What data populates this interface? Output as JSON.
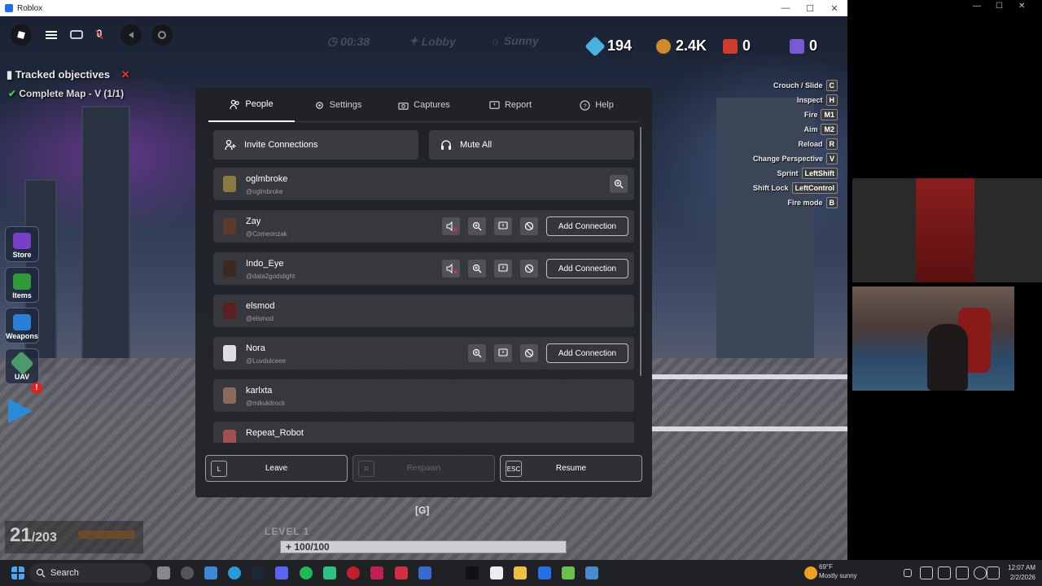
{
  "window": {
    "title": "Roblox",
    "min": "—",
    "max": "☐",
    "close": "✕"
  },
  "hud": {
    "timer": "00:38",
    "mode": "Lobby",
    "weather": "Sunny",
    "gems": "194",
    "burgers": "2.4K",
    "rockets": "0",
    "crystals": "0",
    "tracked_title": "Tracked objectives",
    "objective": "Complete Map - V (1/1)",
    "ammo_current": "21",
    "ammo_total": "/203",
    "level": "LEVEL 1",
    "health": "+ 100/100",
    "g_key": "[G]"
  },
  "keybinds": [
    {
      "label": "Crouch / Slide",
      "key": "C"
    },
    {
      "label": "Inspect",
      "key": "H"
    },
    {
      "label": "Fire",
      "key": "M1"
    },
    {
      "label": "Aim",
      "key": "M2"
    },
    {
      "label": "Reload",
      "key": "R"
    },
    {
      "label": "Change Perspective",
      "key": "V"
    },
    {
      "label": "Sprint",
      "key": "LeftShift"
    },
    {
      "label": "Shift Lock",
      "key": "LeftControl"
    },
    {
      "label": "Fire mode",
      "key": "B"
    }
  ],
  "sidebar": [
    {
      "label": "Store",
      "color": "#7a3fc7"
    },
    {
      "label": "Items",
      "color": "#2f9a3a"
    },
    {
      "label": "Weapons",
      "color": "#2a7fd6"
    },
    {
      "label": "UAV",
      "color": "#4a9a6a"
    }
  ],
  "menu": {
    "tabs": [
      {
        "label": "People",
        "icon": "people-icon"
      },
      {
        "label": "Settings",
        "icon": "gear-icon"
      },
      {
        "label": "Captures",
        "icon": "camera-icon"
      },
      {
        "label": "Report",
        "icon": "report-icon"
      },
      {
        "label": "Help",
        "icon": "help-icon"
      }
    ],
    "invite_label": "Invite Connections",
    "mute_all_label": "Mute All",
    "add_connection_label": "Add Connection",
    "players": [
      {
        "name": "oglmbroke",
        "handle": "@oglmbroke",
        "avatar": "#8a7a40"
      },
      {
        "name": "Zay",
        "handle": "@Comeonzak",
        "avatar": "#5a3a2a"
      },
      {
        "name": "Indo_Eye",
        "handle": "@data2godslight",
        "avatar": "#3a2a20"
      },
      {
        "name": "elsmod",
        "handle": "@elsmod",
        "avatar": "#5a2020"
      },
      {
        "name": "Nora",
        "handle": "@Luvdulceee",
        "avatar": "#dddddd"
      },
      {
        "name": "karlxta",
        "handle": "@mikukitrock",
        "avatar": "#8a6a5a"
      },
      {
        "name": "Repeat_Robot",
        "handle": "",
        "avatar": "#a05050"
      }
    ],
    "footer": [
      {
        "key": "L",
        "label": "Leave"
      },
      {
        "key": "R",
        "label": "Respawn"
      },
      {
        "key": "ESC",
        "label": "Resume"
      }
    ]
  },
  "taskbar": {
    "search": "Search",
    "weather_temp": "69°F",
    "weather_desc": "Mostly sunny",
    "time": "12:07 AM",
    "date": "2/2/2026"
  }
}
